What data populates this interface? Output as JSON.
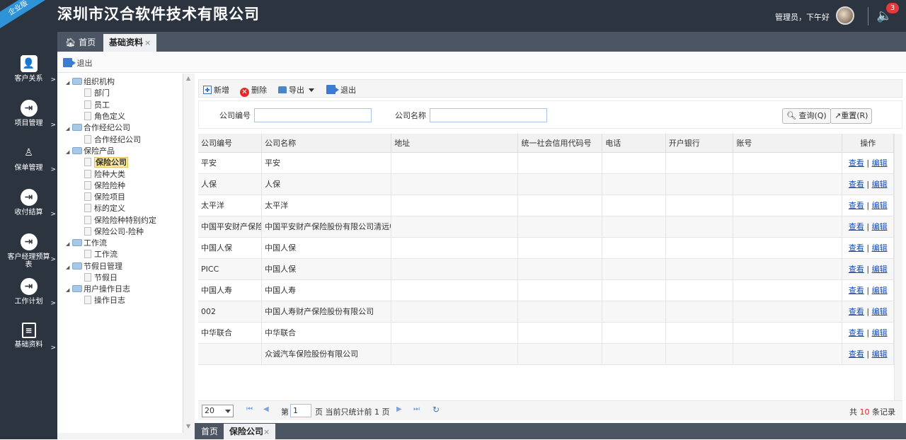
{
  "header": {
    "ribbon": "企业版",
    "brand": "深圳市汉合软件技术有限公司",
    "greeting": "管理员，下午好",
    "notif_count": "3"
  },
  "sidebar": {
    "items": [
      {
        "label": "客户关系",
        "icon": "user-icon"
      },
      {
        "label": "项目管理",
        "icon": "module-icon"
      },
      {
        "label": "保单管理",
        "icon": "person-group-icon"
      },
      {
        "label": "收付结算",
        "icon": "module-icon"
      },
      {
        "label": "客户经理预算表",
        "icon": "module-icon"
      },
      {
        "label": "工作计划",
        "icon": "module-icon"
      },
      {
        "label": "基础资料",
        "icon": "document-icon"
      }
    ],
    "arrow": ">"
  },
  "tabs": {
    "home": "首页",
    "active": "基础资料",
    "close": "×"
  },
  "exitbar": {
    "exit": "退出"
  },
  "tree": {
    "nodes": [
      {
        "label": "组织机构",
        "type": "folder"
      },
      {
        "label": "部门",
        "type": "leaf"
      },
      {
        "label": "员工",
        "type": "leaf"
      },
      {
        "label": "角色定义",
        "type": "leaf"
      },
      {
        "label": "合作经纪公司",
        "type": "folder"
      },
      {
        "label": "合作经纪公司",
        "type": "leaf"
      },
      {
        "label": "保险产品",
        "type": "folder"
      },
      {
        "label": "保险公司",
        "type": "leaf",
        "selected": true
      },
      {
        "label": "险种大类",
        "type": "leaf"
      },
      {
        "label": "保险险种",
        "type": "leaf"
      },
      {
        "label": "保险项目",
        "type": "leaf"
      },
      {
        "label": "标的定义",
        "type": "leaf"
      },
      {
        "label": "保险险种特别约定",
        "type": "leaf"
      },
      {
        "label": "保险公司-险种",
        "type": "leaf"
      },
      {
        "label": "工作流",
        "type": "folder"
      },
      {
        "label": "工作流",
        "type": "leaf"
      },
      {
        "label": "节假日管理",
        "type": "folder"
      },
      {
        "label": "节假日",
        "type": "leaf"
      },
      {
        "label": "用户操作日志",
        "type": "folder"
      },
      {
        "label": "操作日志",
        "type": "leaf"
      }
    ]
  },
  "toolbar": {
    "add": "新增",
    "delete": "删除",
    "export": "导出",
    "exit": "退出"
  },
  "search": {
    "code_label": "公司编号",
    "code_value": "",
    "name_label": "公司名称",
    "name_value": "",
    "query": "查询(Q)",
    "reset": "重置(R)"
  },
  "grid": {
    "columns": [
      "公司编号",
      "公司名称",
      "地址",
      "统一社会信用代码号",
      "电话",
      "开户银行",
      "账号",
      "操作"
    ],
    "view": "查看",
    "edit": "编辑",
    "sep": "|",
    "rows": [
      {
        "code": "平安",
        "name": "平安"
      },
      {
        "code": "人保",
        "name": "人保"
      },
      {
        "code": "太平洋",
        "name": "太平洋"
      },
      {
        "code": "中国平安财产保险股份有限公司清远中心支公司",
        "name": "中国平安财产保险股份有限公司清远中心支公司"
      },
      {
        "code": "中国人保",
        "name": "中国人保"
      },
      {
        "code": "PICC",
        "name": "中国人保"
      },
      {
        "code": "中国人寿",
        "name": "中国人寿"
      },
      {
        "code": "002",
        "name": "中国人寿财产保险股份有限公司"
      },
      {
        "code": "中华联合",
        "name": "中华联合"
      },
      {
        "code": "",
        "name": "众诚汽车保险股份有限公司"
      }
    ]
  },
  "pager": {
    "page_size": "20",
    "page_prefix": "第",
    "page_value": "1",
    "page_suffix": "页 当前只统计前 1 页",
    "total_prefix": "共",
    "total_num": "10",
    "total_suffix": "条记录"
  },
  "bottom_tabs": {
    "home": "首页",
    "active": "保险公司",
    "close": "×"
  }
}
